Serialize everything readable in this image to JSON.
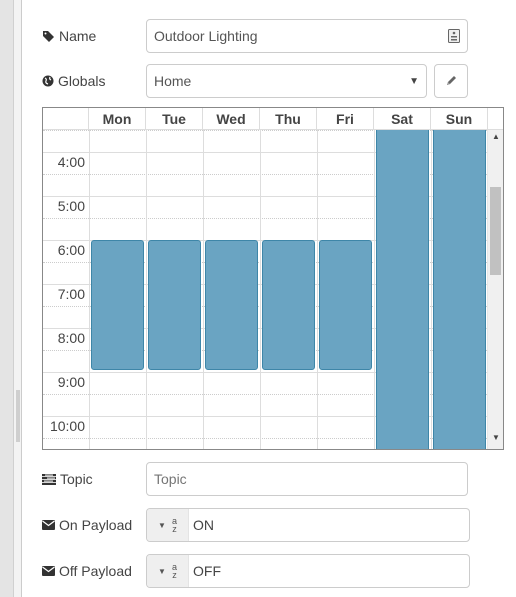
{
  "form": {
    "name": {
      "label": "Name",
      "icon": "tag-icon",
      "value": "Outdoor Lighting",
      "trailing_icon": "properties-icon"
    },
    "globals": {
      "label": "Globals",
      "icon": "globe-icon",
      "selected": "Home",
      "edit_icon": "pencil-icon"
    },
    "topic": {
      "label": "Topic",
      "icon": "tasks-icon",
      "value": "",
      "placeholder": "Topic"
    },
    "on_payload": {
      "label": "On Payload",
      "icon": "envelope-icon",
      "type": "string",
      "type_icon": "az-icon",
      "value": "ON"
    },
    "off_payload": {
      "label": "Off Payload",
      "icon": "envelope-icon",
      "type": "string",
      "type_icon": "az-icon",
      "value": "OFF"
    }
  },
  "schedule": {
    "days": [
      "Mon",
      "Tue",
      "Wed",
      "Thu",
      "Fri",
      "Sat",
      "Sun"
    ],
    "visible_hours": [
      "4:00",
      "5:00",
      "6:00",
      "7:00",
      "8:00",
      "9:00",
      "10:00"
    ],
    "visible_range": {
      "start_hour": 3.5,
      "end_hour": 10.75
    },
    "block_color": "#6aa4c2",
    "block_border_color": "#3e86a8",
    "events": [
      {
        "day": "Mon",
        "start_hour": 6.0,
        "end_hour": 9.0
      },
      {
        "day": "Tue",
        "start_hour": 6.0,
        "end_hour": 9.0
      },
      {
        "day": "Wed",
        "start_hour": 6.0,
        "end_hour": 9.0
      },
      {
        "day": "Thu",
        "start_hour": 6.0,
        "end_hour": 9.0
      },
      {
        "day": "Fri",
        "start_hour": 6.0,
        "end_hour": 9.0
      },
      {
        "day": "Sat",
        "start_hour": 0.0,
        "end_hour": 24.0
      },
      {
        "day": "Sun",
        "start_hour": 0.0,
        "end_hour": 24.0
      }
    ],
    "scroll": {
      "fraction": 0.18
    }
  }
}
